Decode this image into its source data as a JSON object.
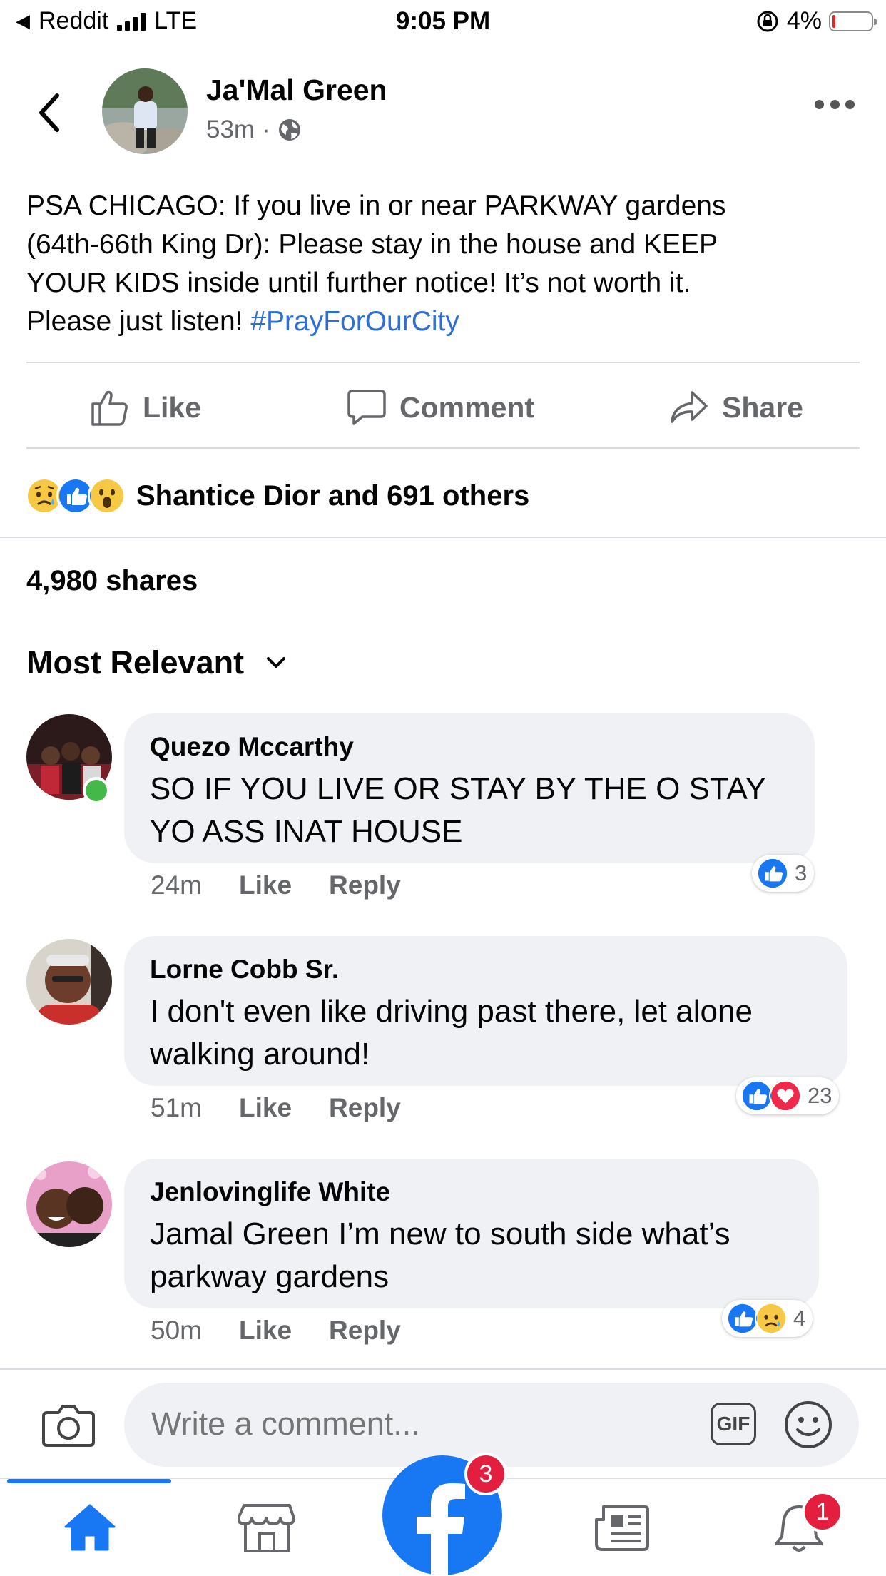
{
  "status_bar": {
    "back_app": "Reddit",
    "network": "LTE",
    "time": "9:05 PM",
    "battery": "4%",
    "battery_level": 0.04
  },
  "post": {
    "author": "Ja'Mal Green",
    "time": "53m",
    "audience_icon": "globe-icon",
    "text_lines": [
      "PSA CHICAGO: If you live in or near PARKWAY gardens",
      "(64th-66th King Dr): Please stay in the house and KEEP",
      "YOUR KIDS inside until further notice! It’s not worth it.",
      "Please just listen! "
    ],
    "hashtag": "#PrayForOurCity"
  },
  "actions": {
    "like": "Like",
    "comment": "Comment",
    "share": "Share"
  },
  "reactions": {
    "icons": [
      "sad-icon",
      "like-icon",
      "wow-icon"
    ],
    "summary": "Shantice Dior and 691 others"
  },
  "shares": "4,980 shares",
  "sort": {
    "label": "Most Relevant"
  },
  "comments": [
    {
      "name": "Quezo Mccarthy",
      "text": [
        "SO IF YOU LIVE OR STAY BY THE O STAY",
        "YO ASS INAT HOUSE"
      ],
      "time": "24m",
      "like": "Like",
      "reply": "Reply",
      "reaction_count": "3",
      "online": true
    },
    {
      "name": "Lorne Cobb Sr.",
      "text": [
        "I don't even like driving past there, let alone",
        "walking around!"
      ],
      "time": "51m",
      "like": "Like",
      "reply": "Reply",
      "reaction_count": "23"
    },
    {
      "name": "Jenlovinglife White",
      "text": [
        "Jamal Green I’m new to south side what’s",
        "parkway gardens"
      ],
      "time": "50m",
      "like": "Like",
      "reply": "Reply",
      "reaction_count": "4"
    }
  ],
  "composer": {
    "placeholder": "Write a comment...",
    "gif": "GIF"
  },
  "tabbar": {
    "facebook_badge": "3",
    "notifications_badge": "1"
  },
  "colors": {
    "accent": "#1877f2",
    "hashtag": "#2e6fd6",
    "badge": "#e41e3f",
    "bubble": "#eff1f4",
    "secondary_text": "#65676b"
  }
}
